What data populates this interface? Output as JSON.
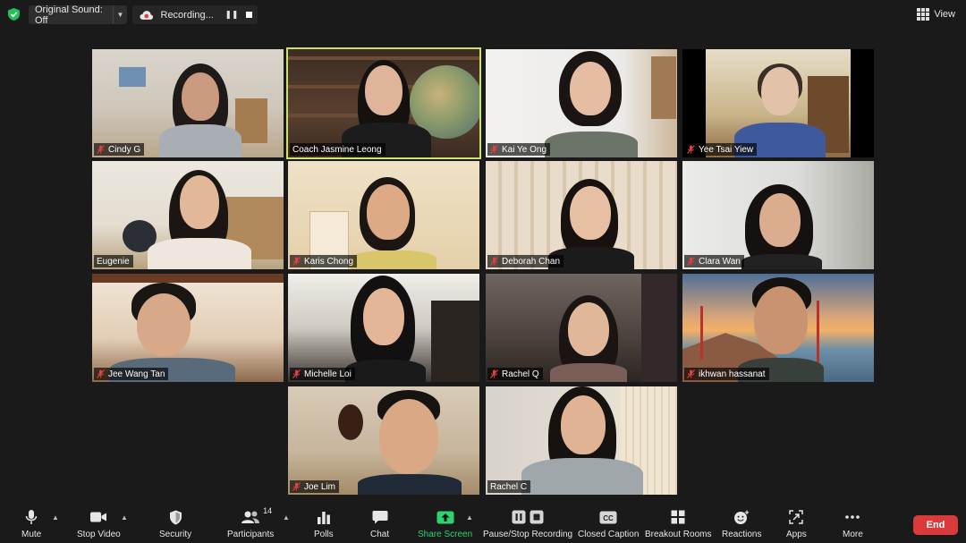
{
  "topbar": {
    "original_sound": "Original Sound: Off",
    "recording_label": "Recording...",
    "view_label": "View"
  },
  "participants": [
    {
      "name": "Cindy G",
      "muted": true
    },
    {
      "name": "Coach Jasmine Leong",
      "muted": false,
      "active_speaker": true
    },
    {
      "name": "Kai Ye Ong",
      "muted": true
    },
    {
      "name": "Yee Tsai Yiew",
      "muted": true
    },
    {
      "name": "Eugenie",
      "muted": false
    },
    {
      "name": "Karis Chong",
      "muted": true
    },
    {
      "name": "Deborah Chan",
      "muted": true
    },
    {
      "name": "Clara Wan",
      "muted": true
    },
    {
      "name": "Jee Wang Tan",
      "muted": true
    },
    {
      "name": "Michelle Loi",
      "muted": true
    },
    {
      "name": "Rachel Q",
      "muted": true
    },
    {
      "name": "ikhwan hassanat",
      "muted": true
    },
    {
      "name": "Joe Lim",
      "muted": true
    },
    {
      "name": "Rachel C",
      "muted": false
    }
  ],
  "toolbar": {
    "mute": "Mute",
    "stop_video": "Stop Video",
    "security": "Security",
    "participants": "Participants",
    "participant_count": "14",
    "polls": "Polls",
    "chat": "Chat",
    "share_screen": "Share Screen",
    "pause_stop_recording": "Pause/Stop Recording",
    "closed_caption": "Closed Caption",
    "breakout_rooms": "Breakout Rooms",
    "reactions": "Reactions",
    "apps": "Apps",
    "more": "More",
    "end": "End"
  },
  "colors": {
    "background": "#1a1a1a",
    "active_speaker_border": "#c8e36b",
    "share_green": "#2dd36f",
    "end_red": "#d93b3b",
    "muted_red": "#e04040"
  }
}
